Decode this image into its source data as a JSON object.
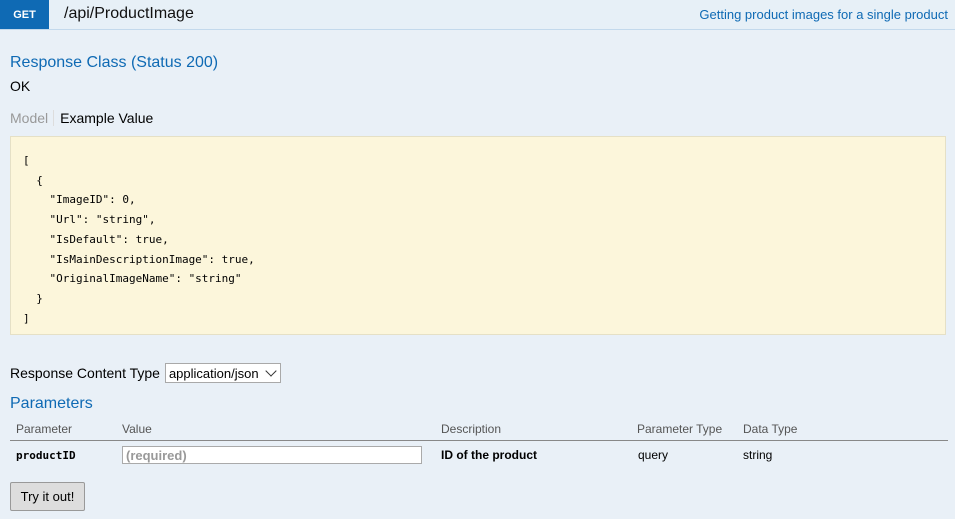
{
  "operation": {
    "method": "GET",
    "path": "/api/ProductImage",
    "summary": "Getting product images for a single product"
  },
  "response": {
    "class_title": "Response Class (Status 200)",
    "status_text": "OK",
    "tabs": {
      "model": "Model",
      "example": "Example Value"
    },
    "example_json": "[\n  {\n    \"ImageID\": 0,\n    \"Url\": \"string\",\n    \"IsDefault\": true,\n    \"IsMainDescriptionImage\": true,\n    \"OriginalImageName\": \"string\"\n  }\n]"
  },
  "content_type": {
    "label": "Response Content Type",
    "selected": "application/json"
  },
  "parameters": {
    "title": "Parameters",
    "headers": [
      "Parameter",
      "Value",
      "Description",
      "Parameter Type",
      "Data Type"
    ],
    "rows": [
      {
        "name": "productID",
        "placeholder": "(required)",
        "description": "ID of the product",
        "param_type": "query",
        "data_type": "string"
      }
    ]
  },
  "try_button": "Try it out!"
}
